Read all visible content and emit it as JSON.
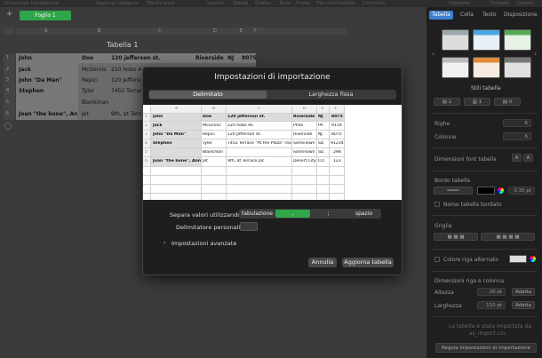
{
  "menubar": {
    "items": [
      "Orizzontale",
      "Intestazione",
      "Aggiungi categoria",
      "Tabella pivot",
      "Inserisci",
      "Tabella",
      "Grafico",
      "Testo",
      "Forma",
      "File multimediale",
      "Commenti",
      "Collabora",
      "Formato",
      "Disponi"
    ]
  },
  "sheet": {
    "tab_label": "Foglio 1",
    "table_title": "Tabella 1",
    "col_headers": [
      "A",
      "B",
      "C",
      "D",
      "E",
      "F"
    ],
    "row_headers": [
      "1",
      "2",
      "3",
      "4",
      "5",
      "6"
    ],
    "rows": [
      [
        "John",
        "Doe",
        "120 jefferson st.",
        "Riverside",
        "NJ",
        "8075"
      ],
      [
        "Jack",
        "McGinnis",
        "220 hobo Av.",
        "",
        "",
        ""
      ],
      [
        "John \"Da Man\"",
        "Repici",
        "120 Jefferson St.",
        "",
        "",
        ""
      ],
      [
        "Stephen",
        "Tyler",
        "7452 Terrace",
        "",
        "",
        ""
      ],
      [
        "",
        "Blankman",
        "",
        "",
        "",
        ""
      ],
      [
        "Joan \"the bone\", Anne",
        "Jet",
        "9th, at Terrace",
        "",
        "",
        ""
      ]
    ]
  },
  "dialog": {
    "title": "Impostazioni di importazione",
    "tabs": [
      "Delimitato",
      "Larghezza fissa"
    ],
    "preview": {
      "col_headers": [
        "A",
        "B",
        "C",
        "D",
        "E",
        "F"
      ],
      "row_headers": [
        "1",
        "2",
        "3",
        "4",
        "5",
        "6"
      ],
      "rows": [
        [
          "John",
          "Doe",
          "120 jefferson st.",
          "Riverside",
          "NJ",
          "8075"
        ],
        [
          "Jack",
          "McGinnis",
          "220 hobo Av.",
          "Phila",
          "PA",
          "9119"
        ],
        [
          "John \"Da Man\"",
          "Repici",
          "120 Jefferson St.",
          "Riverside",
          "NJ",
          "8075"
        ],
        [
          "Stephen",
          "Tyler",
          "7452 Terrace \"At the Plaza\" road",
          "SomeTown",
          "SD",
          "91234"
        ],
        [
          "",
          "Blankman",
          "",
          "SomeTown",
          "SD",
          "298"
        ],
        [
          "Joan \"the bone\", Anne",
          "Jet",
          "9th, at Terrace plc",
          "Desert City",
          "CO",
          "123"
        ]
      ]
    },
    "separator_label": "Separa valori utilizzando:",
    "separators": [
      "tabulazione",
      ",",
      ";",
      "spazio"
    ],
    "custom_delimiter_label": "Delimitatore personalizzato:",
    "advanced_label": "Impostazioni avanzate",
    "cancel_label": "Annulla",
    "update_label": "Aggiorna tabella"
  },
  "inspector": {
    "tabs": [
      "Tabella",
      "Cella",
      "Testo",
      "Disposizione"
    ],
    "styles_label": "Stili tabella",
    "rows_label": "Righe",
    "rows_value": "6",
    "cols_label": "Colonne",
    "cols_value": "6",
    "font_size_label": "Dimensioni font tabella",
    "border_label": "Bordo tabella",
    "border_width": "0,35 pt",
    "name_border_label": "Nome tabella bordato",
    "grid_label": "Griglia",
    "alt_row_label": "Colore riga alternato",
    "row_col_size_label": "Dimensioni riga e colonna",
    "height_label": "Altezza",
    "height_value": "20 pt",
    "width_label": "Larghezza",
    "width_value": "110 pt",
    "adapt_label": "Adatta",
    "import_note": "La tabella è stata importata da",
    "import_file": "as_import.csv",
    "import_settings_button": "Regola impostazioni di importazione"
  },
  "colors": {
    "accent": "#3f7fd0",
    "sheet_tab": "#2fa64a",
    "selected_separator": "#2fa64a"
  }
}
